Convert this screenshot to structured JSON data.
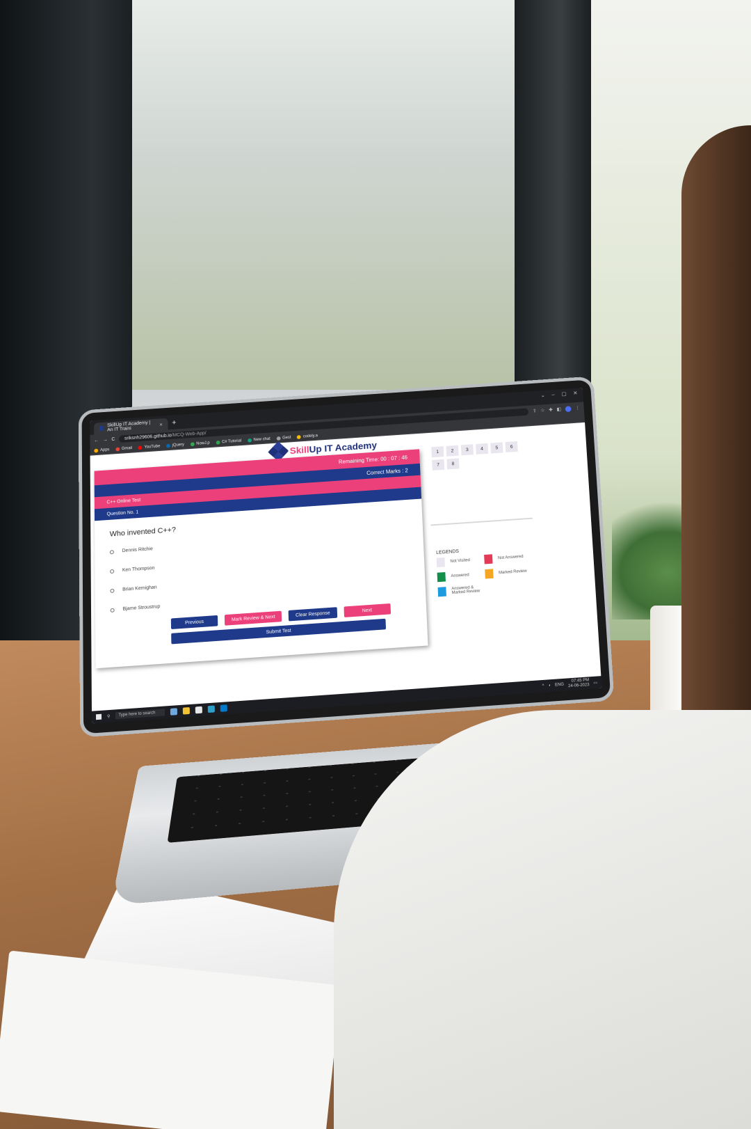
{
  "browser": {
    "tab_title": "SkillUp IT Academy | An IT Traini",
    "tab_close": "×",
    "new_tab": "+",
    "window_controls": [
      "⌄",
      "–",
      "▢",
      "✕"
    ],
    "url_host": "sriksnh29606.github.io",
    "url_path": "/MCQ-Web-App/",
    "nav_back": "←",
    "nav_forward": "→",
    "nav_reload": "C",
    "bookmarks": [
      {
        "label": "Apps",
        "color": "#f9ab00"
      },
      {
        "label": "Gmail",
        "color": "#ea4335"
      },
      {
        "label": "YouTube",
        "color": "#ff0000"
      },
      {
        "label": "jQuery",
        "color": "#0769ad"
      },
      {
        "label": "NowJ.p",
        "color": "#34a853"
      },
      {
        "label": "C# Tutorial",
        "color": "#2ea44f"
      },
      {
        "label": "New chat",
        "color": "#10a37f"
      },
      {
        "label": "Gest",
        "color": "#9aa0a6"
      },
      {
        "label": "codely.a",
        "color": "#fbbc04"
      }
    ]
  },
  "brand": {
    "name_accent": "Skill",
    "name_rest": "Up IT Academy",
    "accent_color": "#ec407a",
    "primary_color": "#1f3a8a"
  },
  "quiz": {
    "remaining_time_label": "Remaining Time: 00 : 07 : 46",
    "correct_marks_label": "Correct Marks : 2",
    "test_name": "C++ Online Test",
    "question_number_label": "Question No. 1",
    "question_text": "Who invented C++?",
    "options": [
      "Dennis Ritchie",
      "Ken Thompson",
      "Brian Kernighan",
      "Bjarne Stroustrup"
    ],
    "buttons": {
      "previous": "Previous",
      "mark_review_next": "Mark Review & Next",
      "clear_response": "Clear Response",
      "next": "Next",
      "submit_test": "Submit Test"
    }
  },
  "palette": {
    "question_numbers": [
      "1",
      "2",
      "3",
      "4",
      "5",
      "6",
      "7",
      "8"
    ],
    "legends_title": "LEGENDS",
    "legends": [
      {
        "label": "Not Visited",
        "color": "#e9e6ef"
      },
      {
        "label": "Not Answered",
        "color": "#e53958"
      },
      {
        "label": "Answered",
        "color": "#12904a"
      },
      {
        "label": "Marked Review",
        "color": "#f5a623"
      },
      {
        "label": "Answered & Marked Review",
        "color": "#1e9be0"
      }
    ]
  },
  "taskbar": {
    "search_placeholder": "Type here to search",
    "language": "ENG",
    "time": "07:45 PM",
    "date": "24-06-2023"
  }
}
